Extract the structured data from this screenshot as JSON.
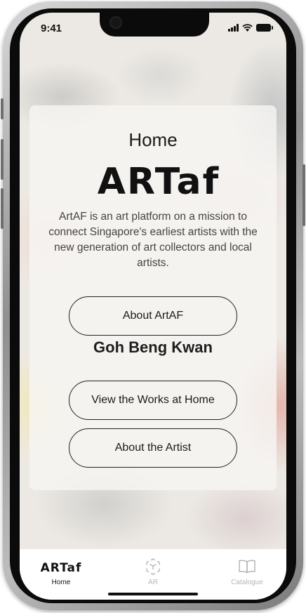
{
  "status_bar": {
    "time": "9:41"
  },
  "screen": {
    "title": "Home",
    "logo_text": "ARTaf",
    "intro": "ArtAF is an art platform on a mission to connect Singapore's earliest artists with the new generation of art collectors and local artists.",
    "about_button": "About ArtAF",
    "artist_name": "Goh Beng Kwan",
    "works_button": "View the Works at Home",
    "artist_button": "About the Artist"
  },
  "tabbar": {
    "items": [
      {
        "label": "Home",
        "icon": "artaf-logo-icon",
        "active": true
      },
      {
        "label": "AR",
        "icon": "ar-cube-icon",
        "active": false
      },
      {
        "label": "Catalogue",
        "icon": "open-book-icon",
        "active": false
      }
    ],
    "active_color": "#111111",
    "inactive_color": "#b5b5b5"
  }
}
